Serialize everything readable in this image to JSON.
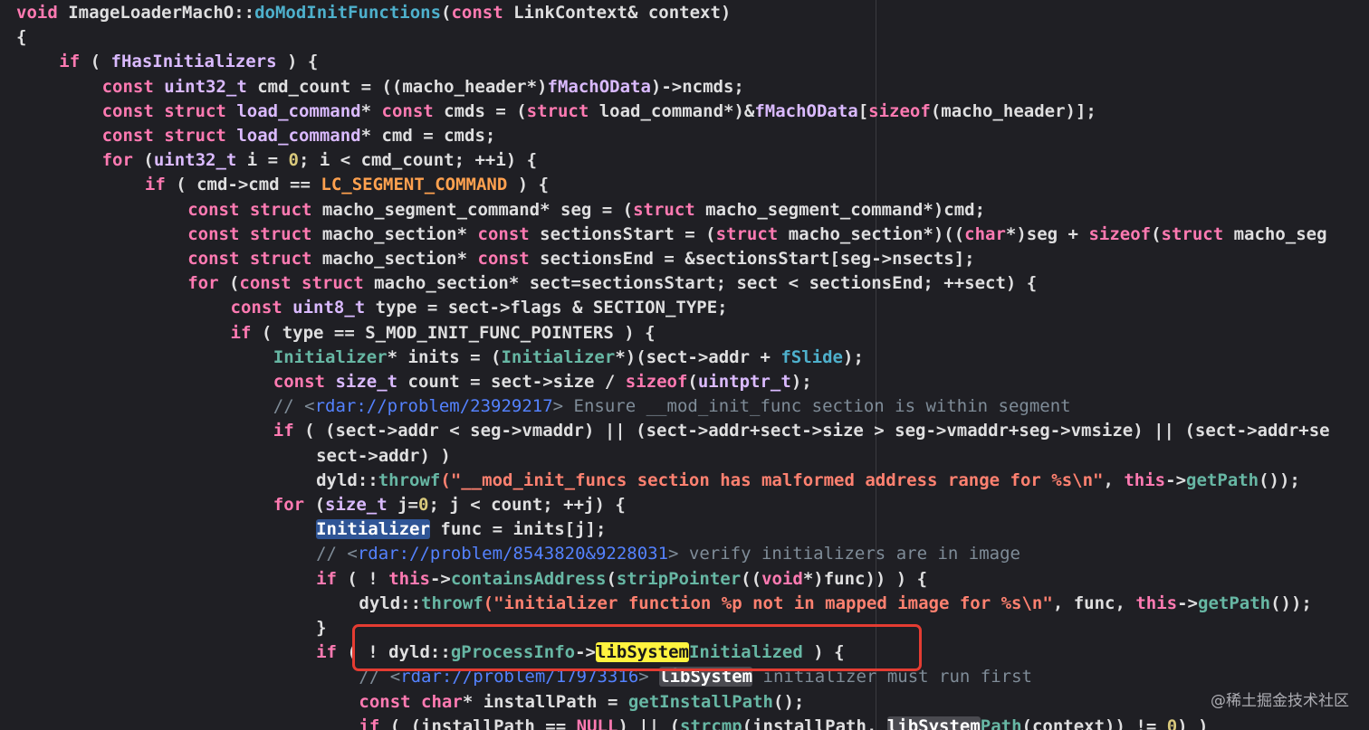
{
  "code": {
    "lines": [
      {
        "indent": 0,
        "tokens": [
          {
            "t": "void",
            "c": "kw"
          },
          {
            "t": " ImageLoaderMachO::"
          },
          {
            "t": "doModInitFunctions",
            "c": "fn"
          },
          {
            "t": "("
          },
          {
            "t": "const",
            "c": "kw"
          },
          {
            "t": " LinkContext& context)"
          }
        ]
      },
      {
        "indent": 0,
        "tokens": [
          {
            "t": "{"
          }
        ]
      },
      {
        "indent": 1,
        "tokens": [
          {
            "t": "if",
            "c": "kw"
          },
          {
            "t": " ( "
          },
          {
            "t": "fHasInitializers",
            "c": "ty"
          },
          {
            "t": " ) {"
          }
        ]
      },
      {
        "indent": 2,
        "tokens": [
          {
            "t": "const",
            "c": "kw"
          },
          {
            "t": " "
          },
          {
            "t": "uint32_t",
            "c": "ty"
          },
          {
            "t": " cmd_count = ((macho_header*)"
          },
          {
            "t": "fMachOData",
            "c": "ty"
          },
          {
            "t": ")->ncmds;"
          }
        ]
      },
      {
        "indent": 2,
        "tokens": [
          {
            "t": "const struct",
            "c": "kw"
          },
          {
            "t": " "
          },
          {
            "t": "load_command",
            "c": "ty"
          },
          {
            "t": "* "
          },
          {
            "t": "const",
            "c": "kw"
          },
          {
            "t": " cmds = ("
          },
          {
            "t": "struct",
            "c": "kw"
          },
          {
            "t": " load_command*)&"
          },
          {
            "t": "fMachOData",
            "c": "ty"
          },
          {
            "t": "["
          },
          {
            "t": "sizeof",
            "c": "kw"
          },
          {
            "t": "(macho_header)];"
          }
        ]
      },
      {
        "indent": 2,
        "tokens": [
          {
            "t": "const struct",
            "c": "kw"
          },
          {
            "t": " "
          },
          {
            "t": "load_command",
            "c": "ty"
          },
          {
            "t": "* cmd = cmds;"
          }
        ]
      },
      {
        "indent": 2,
        "tokens": [
          {
            "t": "for",
            "c": "kw"
          },
          {
            "t": " ("
          },
          {
            "t": "uint32_t",
            "c": "ty"
          },
          {
            "t": " i = "
          },
          {
            "t": "0",
            "c": "num"
          },
          {
            "t": "; i < cmd_count; ++i) {"
          }
        ]
      },
      {
        "indent": 3,
        "tokens": [
          {
            "t": "if",
            "c": "kw"
          },
          {
            "t": " ( cmd->cmd == "
          },
          {
            "t": "LC_SEGMENT_COMMAND",
            "c": "mac"
          },
          {
            "t": " ) {"
          }
        ]
      },
      {
        "indent": 4,
        "tokens": [
          {
            "t": "const struct",
            "c": "kw"
          },
          {
            "t": " macho_segment_command* seg = ("
          },
          {
            "t": "struct",
            "c": "kw"
          },
          {
            "t": " macho_segment_command*)cmd;"
          }
        ]
      },
      {
        "indent": 4,
        "tokens": [
          {
            "t": "const struct",
            "c": "kw"
          },
          {
            "t": " macho_section* "
          },
          {
            "t": "const",
            "c": "kw"
          },
          {
            "t": " sectionsStart = ("
          },
          {
            "t": "struct",
            "c": "kw"
          },
          {
            "t": " macho_section*)(("
          },
          {
            "t": "char",
            "c": "kw"
          },
          {
            "t": "*)seg + "
          },
          {
            "t": "sizeof",
            "c": "kw"
          },
          {
            "t": "("
          },
          {
            "t": "struct",
            "c": "kw"
          },
          {
            "t": " macho_seg"
          }
        ]
      },
      {
        "indent": 4,
        "tokens": [
          {
            "t": "const struct",
            "c": "kw"
          },
          {
            "t": " macho_section* "
          },
          {
            "t": "const",
            "c": "kw"
          },
          {
            "t": " sectionsEnd = &sectionsStart[seg->nsects];"
          }
        ]
      },
      {
        "indent": 4,
        "tokens": [
          {
            "t": "for",
            "c": "kw"
          },
          {
            "t": " ("
          },
          {
            "t": "const struct",
            "c": "kw"
          },
          {
            "t": " macho_section* sect=sectionsStart; sect < sectionsEnd; ++sect) {"
          }
        ]
      },
      {
        "indent": 5,
        "tokens": [
          {
            "t": "const",
            "c": "kw"
          },
          {
            "t": " "
          },
          {
            "t": "uint8_t",
            "c": "ty"
          },
          {
            "t": " type = sect->flags & SECTION_TYPE;"
          }
        ]
      },
      {
        "indent": 5,
        "tokens": [
          {
            "t": "if",
            "c": "kw"
          },
          {
            "t": " ( type == S_MOD_INIT_FUNC_POINTERS ) {"
          }
        ]
      },
      {
        "indent": 6,
        "tokens": [
          {
            "t": "Initializer",
            "c": "call"
          },
          {
            "t": "* inits = ("
          },
          {
            "t": "Initializer",
            "c": "call"
          },
          {
            "t": "*)(sect->addr + "
          },
          {
            "t": "fSlide",
            "c": "fn"
          },
          {
            "t": ");"
          }
        ]
      },
      {
        "indent": 6,
        "tokens": [
          {
            "t": "const",
            "c": "kw"
          },
          {
            "t": " "
          },
          {
            "t": "size_t",
            "c": "ty"
          },
          {
            "t": " count = sect->size / "
          },
          {
            "t": "sizeof",
            "c": "kw"
          },
          {
            "t": "("
          },
          {
            "t": "uintptr_t",
            "c": "ty"
          },
          {
            "t": ");"
          }
        ]
      },
      {
        "indent": 6,
        "tokens": [
          {
            "t": "// <",
            "c": "cmt"
          },
          {
            "t": "rdar://problem/23929217",
            "c": "link"
          },
          {
            "t": "> Ensure __mod_init_func section is within segment",
            "c": "cmt"
          }
        ]
      },
      {
        "indent": 6,
        "tokens": [
          {
            "t": "if",
            "c": "kw"
          },
          {
            "t": " ( (sect->addr < seg->vmaddr) || (sect->addr+sect->size > seg->vmaddr+seg->vmsize) || (sect->addr+se"
          }
        ]
      },
      {
        "indent": 7,
        "tokens": [
          {
            "t": "sect->addr) )"
          }
        ]
      },
      {
        "indent": 7,
        "tokens": [
          {
            "t": "dyld::"
          },
          {
            "t": "throwf",
            "c": "call"
          },
          {
            "t": "(\"__mod_init_funcs section has malformed address range for %s\\n\"",
            "c": "str"
          },
          {
            "t": ", "
          },
          {
            "t": "this",
            "c": "kw"
          },
          {
            "t": "->"
          },
          {
            "t": "getPath",
            "c": "call"
          },
          {
            "t": "());"
          }
        ]
      },
      {
        "indent": 6,
        "tokens": [
          {
            "t": "for",
            "c": "kw"
          },
          {
            "t": " ("
          },
          {
            "t": "size_t",
            "c": "ty"
          },
          {
            "t": " j="
          },
          {
            "t": "0",
            "c": "num"
          },
          {
            "t": "; j < count; ++j) {"
          }
        ]
      },
      {
        "indent": 7,
        "tokens": [
          {
            "t": "Initializer",
            "c": "hl-blue"
          },
          {
            "t": " func = inits[j];"
          }
        ]
      },
      {
        "indent": 7,
        "tokens": [
          {
            "t": "// <",
            "c": "cmt"
          },
          {
            "t": "rdar://problem/8543820&9228031",
            "c": "link"
          },
          {
            "t": "> verify initializers are in image",
            "c": "cmt"
          }
        ]
      },
      {
        "indent": 7,
        "tokens": [
          {
            "t": "if",
            "c": "kw"
          },
          {
            "t": " ( ! "
          },
          {
            "t": "this",
            "c": "kw"
          },
          {
            "t": "->"
          },
          {
            "t": "containsAddress",
            "c": "call"
          },
          {
            "t": "("
          },
          {
            "t": "stripPointer",
            "c": "call"
          },
          {
            "t": "(("
          },
          {
            "t": "void",
            "c": "kw"
          },
          {
            "t": "*)func)) ) {"
          }
        ]
      },
      {
        "indent": 8,
        "tokens": [
          {
            "t": "dyld::"
          },
          {
            "t": "throwf",
            "c": "call"
          },
          {
            "t": "(\"initializer function %p not in mapped image for %s\\n\"",
            "c": "str"
          },
          {
            "t": ", func, "
          },
          {
            "t": "this",
            "c": "kw"
          },
          {
            "t": "->"
          },
          {
            "t": "getPath",
            "c": "call"
          },
          {
            "t": "());"
          }
        ]
      },
      {
        "indent": 7,
        "tokens": [
          {
            "t": "}"
          }
        ]
      },
      {
        "indent": 7,
        "tokens": [
          {
            "t": "if",
            "c": "kw"
          },
          {
            "t": " ( ! dyld::"
          },
          {
            "t": "gProcessInfo",
            "c": "call"
          },
          {
            "t": "->"
          },
          {
            "t": "libSystem",
            "c": "hl-yellow"
          },
          {
            "t": "Initialized",
            "c": "call"
          },
          {
            "t": " ) {"
          }
        ]
      },
      {
        "indent": 8,
        "tokens": [
          {
            "t": "// <",
            "c": "cmt"
          },
          {
            "t": "rdar://problem/17973316",
            "c": "link"
          },
          {
            "t": "> ",
            "c": "cmt"
          },
          {
            "t": "libSystem",
            "c": "hl-gray"
          },
          {
            "t": " initializer must run first",
            "c": "cmt"
          }
        ]
      },
      {
        "indent": 8,
        "tokens": [
          {
            "t": "const",
            "c": "kw"
          },
          {
            "t": " "
          },
          {
            "t": "char",
            "c": "kw"
          },
          {
            "t": "* installPath = "
          },
          {
            "t": "getInstallPath",
            "c": "call"
          },
          {
            "t": "();"
          }
        ]
      },
      {
        "indent": 8,
        "tokens": [
          {
            "t": "if",
            "c": "kw"
          },
          {
            "t": " ( (installPath == "
          },
          {
            "t": "NULL",
            "c": "kw"
          },
          {
            "t": ") || ("
          },
          {
            "t": "strcmp",
            "c": "call"
          },
          {
            "t": "(installPath, "
          },
          {
            "t": "libSystem",
            "c": "hl-gray"
          },
          {
            "t": "Path",
            "c": "call"
          },
          {
            "t": "(context)) != "
          },
          {
            "t": "0",
            "c": "num"
          },
          {
            "t": ") )"
          }
        ]
      }
    ]
  },
  "watermark": "@稀土掘金技术社区"
}
